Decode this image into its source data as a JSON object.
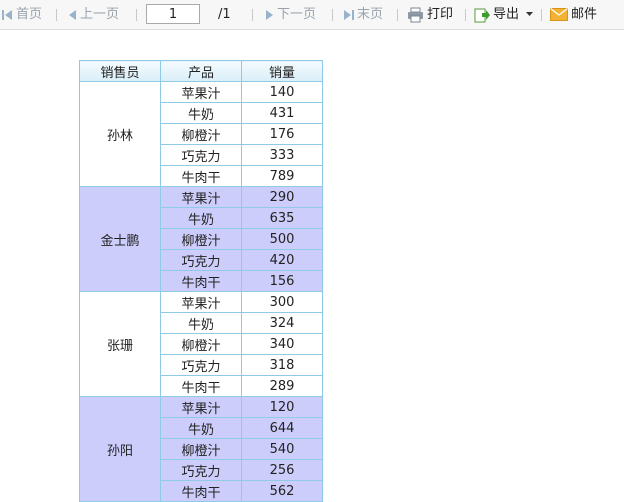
{
  "toolbar": {
    "first_label": "首页",
    "prev_label": "上一页",
    "page_value": "1",
    "page_total": "/1",
    "next_label": "下一页",
    "last_label": "末页",
    "print_label": "打印",
    "export_label": "导出",
    "mail_label": "邮件",
    "icons": {
      "first": "first-page-icon",
      "prev": "prev-page-icon",
      "next": "next-page-icon",
      "last": "last-page-icon",
      "print": "printer-icon",
      "export": "export-icon",
      "export_menu": "caret-down-icon",
      "mail": "mail-icon"
    }
  },
  "report": {
    "headers": [
      "销售员",
      "产品",
      "销量"
    ],
    "groups": [
      {
        "salesperson": "孙林",
        "rows": [
          {
            "product": "苹果汁",
            "sales": "140"
          },
          {
            "product": "牛奶",
            "sales": "431"
          },
          {
            "product": "柳橙汁",
            "sales": "176"
          },
          {
            "product": "巧克力",
            "sales": "333"
          },
          {
            "product": "牛肉干",
            "sales": "789"
          }
        ]
      },
      {
        "salesperson": "金士鹏",
        "rows": [
          {
            "product": "苹果汁",
            "sales": "290"
          },
          {
            "product": "牛奶",
            "sales": "635"
          },
          {
            "product": "柳橙汁",
            "sales": "500"
          },
          {
            "product": "巧克力",
            "sales": "420"
          },
          {
            "product": "牛肉干",
            "sales": "156"
          }
        ]
      },
      {
        "salesperson": "张珊",
        "rows": [
          {
            "product": "苹果汁",
            "sales": "300"
          },
          {
            "product": "牛奶",
            "sales": "324"
          },
          {
            "product": "柳橙汁",
            "sales": "340"
          },
          {
            "product": "巧克力",
            "sales": "318"
          },
          {
            "product": "牛肉干",
            "sales": "289"
          }
        ]
      },
      {
        "salesperson": "孙阳",
        "rows": [
          {
            "product": "苹果汁",
            "sales": "120"
          },
          {
            "product": "牛奶",
            "sales": "644"
          },
          {
            "product": "柳橙汁",
            "sales": "540"
          },
          {
            "product": "巧克力",
            "sales": "256"
          },
          {
            "product": "牛肉干",
            "sales": "562"
          }
        ]
      }
    ]
  },
  "colors": {
    "group_alt_bg": "#cdcdfb",
    "border": "#8fcbe6"
  }
}
